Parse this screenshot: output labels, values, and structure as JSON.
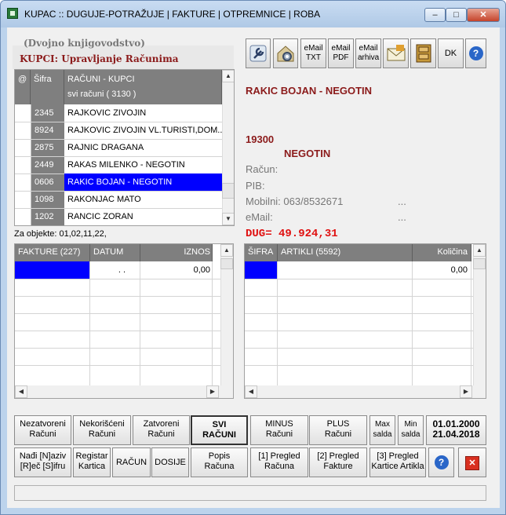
{
  "window": {
    "title": "KUPAC :: DUGUJE-POTRAŽUJE | FAKTURE | OTPREMNICE | ROBA",
    "controls": {
      "minimize": "‒",
      "maximize": "□",
      "close": "✕"
    }
  },
  "section": {
    "subtitle": "(Dvojno knjigovodstvo)",
    "title": "KUPCI: Upravljanje Računima"
  },
  "client_grid": {
    "col_at": "@",
    "col_sifra": "Šifra",
    "col_name": "RAČUNI - KUPCI",
    "col_name_sub": "svi računi  ( 3130 )",
    "rows": [
      {
        "code": "2345",
        "name": "RAJKOVIC ZIVOJIN",
        "selected": false
      },
      {
        "code": "8924",
        "name": "RAJKOVIC ZIVOJIN VL.TURISTI,DOM...",
        "selected": false
      },
      {
        "code": "2875",
        "name": "RAJNIC DRAGANA",
        "selected": false
      },
      {
        "code": "2449",
        "name": "RAKAS MILENKO - NEGOTIN",
        "selected": false
      },
      {
        "code": "0606",
        "name": "RAKIC BOJAN - NEGOTIN",
        "selected": true
      },
      {
        "code": "1098",
        "name": "RAKONJAC MATO",
        "selected": false
      },
      {
        "code": "1202",
        "name": "RANCIC ZORAN",
        "selected": false
      }
    ]
  },
  "za_objekte": "Za objekte: 01,02,11,22,",
  "toolbar": {
    "email_txt": "eMail TXT",
    "email_pdf": "eMail PDF",
    "email_arhiva": "eMail arhiva",
    "dk": "DK",
    "help": "?"
  },
  "client_info": {
    "name": "RAKIC BOJAN - NEGOTIN",
    "postcode": "19300",
    "city": "NEGOTIN",
    "racun_label": "Račun:",
    "pib_label": "PIB:",
    "mobilni": "Mobilni: 063/8532671",
    "mobilni_dots": "...",
    "email_label": "eMail:",
    "email_dots": "...",
    "dug": "DUG=  49.924,31"
  },
  "invoice_grid": {
    "col_fakture": "FAKTURE  (227)",
    "col_datum": "DATUM",
    "col_iznos": "IZNOS",
    "row_datum": ". .",
    "row_iznos": "0,00"
  },
  "article_grid": {
    "col_sifra": "ŠIFRA",
    "col_artikli": "ARTIKLI  (5592)",
    "col_kolicina": "Količina",
    "row_kolicina": "0,00"
  },
  "buttons": {
    "nezatvoreni": [
      "Nezatvoreni",
      "Računi"
    ],
    "nekorisceni": [
      "Nekorišćeni",
      "Računi"
    ],
    "zatvoreni": [
      "Zatvoreni",
      "Računi"
    ],
    "svi": [
      "SVI",
      "RAČUNI"
    ],
    "minus": [
      "MINUS",
      "Računi"
    ],
    "plus": [
      "PLUS",
      "Računi"
    ],
    "max": [
      "Max",
      "salda"
    ],
    "min": [
      "Min",
      "salda"
    ],
    "dates": [
      "01.01.2000",
      "21.04.2018"
    ],
    "nadji": [
      "Nađi [N]aziv",
      "[R]eč [S]ifru"
    ],
    "registar": [
      "Registar",
      "Kartica"
    ],
    "racun": "RAČUN",
    "dosije": "DOSIJE",
    "popis": [
      "Popis",
      "Računa"
    ],
    "pregled_racuna": [
      "[1] Pregled",
      "Računa"
    ],
    "pregled_fakture": [
      "[2] Pregled",
      "Fakture"
    ],
    "pregled_kartice": [
      "[3] Pregled",
      "Kartice Artikla"
    ],
    "help": "?",
    "close": "✕"
  },
  "colors": {
    "accent_red": "#8b1a1a",
    "selection": "#0000ff",
    "dug_red": "#e01010",
    "header_gray": "#7f7f7f"
  }
}
